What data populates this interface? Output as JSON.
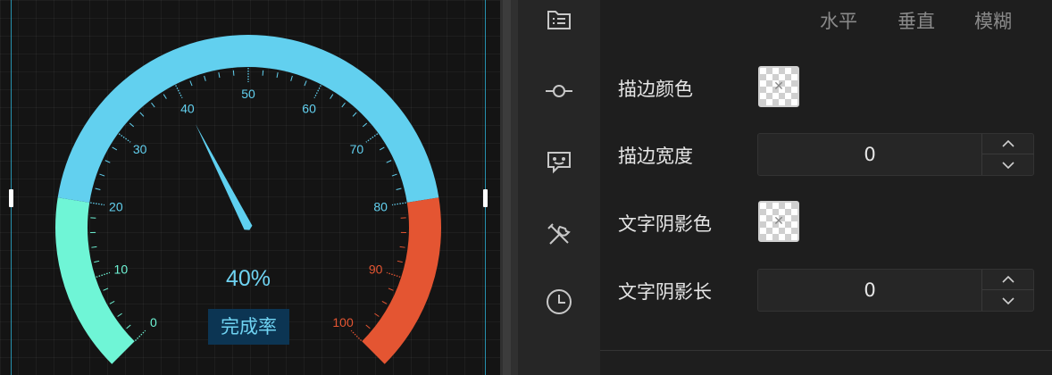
{
  "gauge": {
    "percent_label": "40%",
    "value": 40,
    "min": 0,
    "max": 100,
    "ticks": [
      "0",
      "10",
      "20",
      "30",
      "40",
      "50",
      "60",
      "70",
      "80",
      "90",
      "100"
    ],
    "caption": "完成率",
    "colors": {
      "low": "#6ff5d6",
      "mid": "#62d0ef",
      "high": "#e45532",
      "pointer": "#5fd0f0",
      "caption_bg": "#0c3553",
      "accent_text": "#6fd3f2"
    }
  },
  "sidebar": {
    "icons": [
      "folder-list-icon",
      "commit-node-icon",
      "chat-bubble-icon",
      "tools-icon",
      "clock-history-icon"
    ]
  },
  "panel": {
    "columns": [
      "水平",
      "垂直",
      "模糊"
    ],
    "stroke_color_label": "描边颜色",
    "stroke_width_label": "描边宽度",
    "stroke_width_value": "0",
    "text_shadow_color_label": "文字阴影色",
    "text_shadow_length_label": "文字阴影长",
    "text_shadow_length_value": "0"
  }
}
